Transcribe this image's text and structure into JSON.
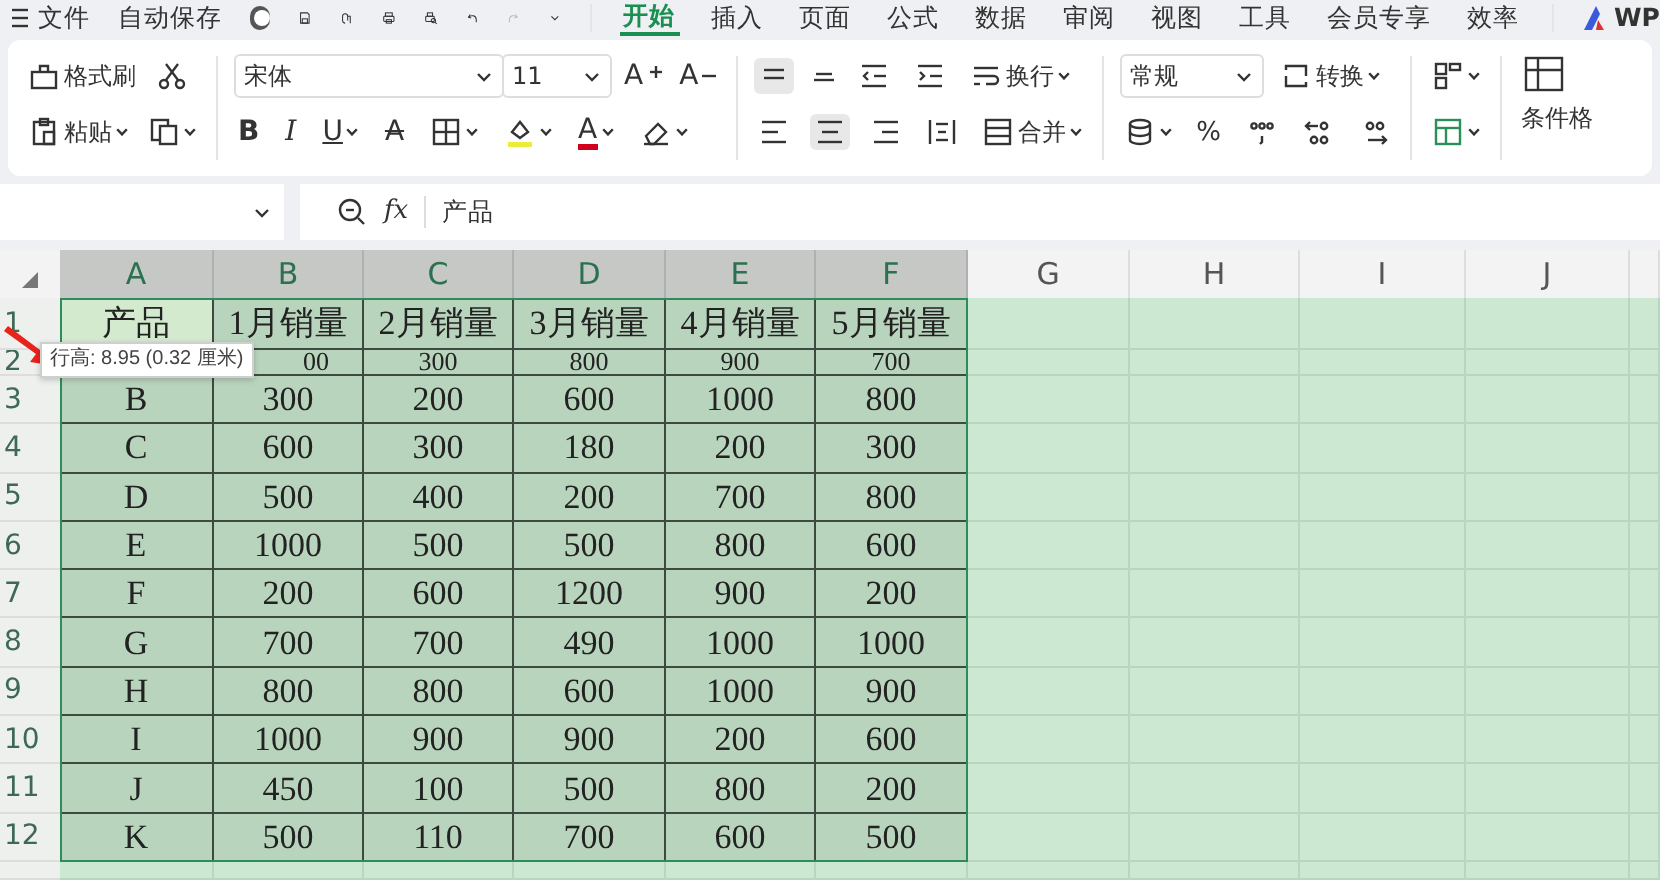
{
  "menu_bar": {
    "file": "文件",
    "autosave": {
      "label": "自动保存",
      "on": false
    },
    "undo": {
      "disabled": false
    },
    "redo": {
      "disabled": true
    },
    "tabs": [
      {
        "label": "开始",
        "selected": true
      },
      {
        "label": "插入",
        "selected": false
      },
      {
        "label": "页面",
        "selected": false
      },
      {
        "label": "公式",
        "selected": false
      },
      {
        "label": "数据",
        "selected": false
      },
      {
        "label": "审阅",
        "selected": false
      },
      {
        "label": "视图",
        "selected": false
      },
      {
        "label": "工具",
        "selected": false
      },
      {
        "label": "会员专享",
        "selected": false
      },
      {
        "label": "效率",
        "selected": false
      }
    ],
    "brand": "WP"
  },
  "ribbon": {
    "format_painter": "格式刷",
    "paste": "粘贴",
    "font": "宋体",
    "font_size": "11",
    "font_grow": "A",
    "font_shrink": "A",
    "bold": "B",
    "italic": "I",
    "underline": "U",
    "strikethrough": "A",
    "font_color": "A",
    "wrap": "换行",
    "merge": "合并",
    "number_format": "常规",
    "convert": "转换",
    "percent": "%",
    "conditional_format": "条件格"
  },
  "formula_bar": {
    "fx": "fx",
    "formula": "产品"
  },
  "sheet": {
    "columns": [
      {
        "label": "A",
        "selected": true
      },
      {
        "label": "B",
        "selected": true
      },
      {
        "label": "C",
        "selected": true
      },
      {
        "label": "D",
        "selected": true
      },
      {
        "label": "E",
        "selected": true
      },
      {
        "label": "F",
        "selected": true
      },
      {
        "label": "G",
        "selected": false
      },
      {
        "label": "H",
        "selected": false
      },
      {
        "label": "I",
        "selected": false
      },
      {
        "label": "J",
        "selected": false
      }
    ],
    "rows": [
      {
        "label": "1",
        "cells": [
          {
            "text": "产品",
            "active": true
          },
          "1月销量",
          "2月销量",
          "3月销量",
          "4月销量",
          "5月销量"
        ]
      },
      {
        "label": "2",
        "cells": [
          null,
          "00",
          "300",
          "800",
          "900",
          "700"
        ]
      },
      {
        "label": "3",
        "cells": [
          "B",
          "300",
          "200",
          "600",
          "1000",
          "800"
        ]
      },
      {
        "label": "4",
        "cells": [
          "C",
          "600",
          "300",
          "180",
          "200",
          "300"
        ]
      },
      {
        "label": "5",
        "cells": [
          "D",
          "500",
          "400",
          "200",
          "700",
          "800"
        ]
      },
      {
        "label": "6",
        "cells": [
          "E",
          "1000",
          "500",
          "500",
          "800",
          "600"
        ]
      },
      {
        "label": "7",
        "cells": [
          "F",
          "200",
          "600",
          "1200",
          "900",
          "200"
        ]
      },
      {
        "label": "8",
        "cells": [
          "G",
          "700",
          "700",
          "490",
          "1000",
          "1000"
        ]
      },
      {
        "label": "9",
        "cells": [
          "H",
          "800",
          "800",
          "600",
          "1000",
          "900"
        ]
      },
      {
        "label": "10",
        "cells": [
          "I",
          "1000",
          "900",
          "900",
          "200",
          "600"
        ]
      },
      {
        "label": "11",
        "cells": [
          "J",
          "450",
          "100",
          "500",
          "800",
          "200"
        ]
      },
      {
        "label": "12",
        "cells": [
          "K",
          "500",
          "110",
          "700",
          "600",
          "500"
        ]
      }
    ],
    "tooltip": "行高: 8.95 (0.32 厘米)"
  }
}
